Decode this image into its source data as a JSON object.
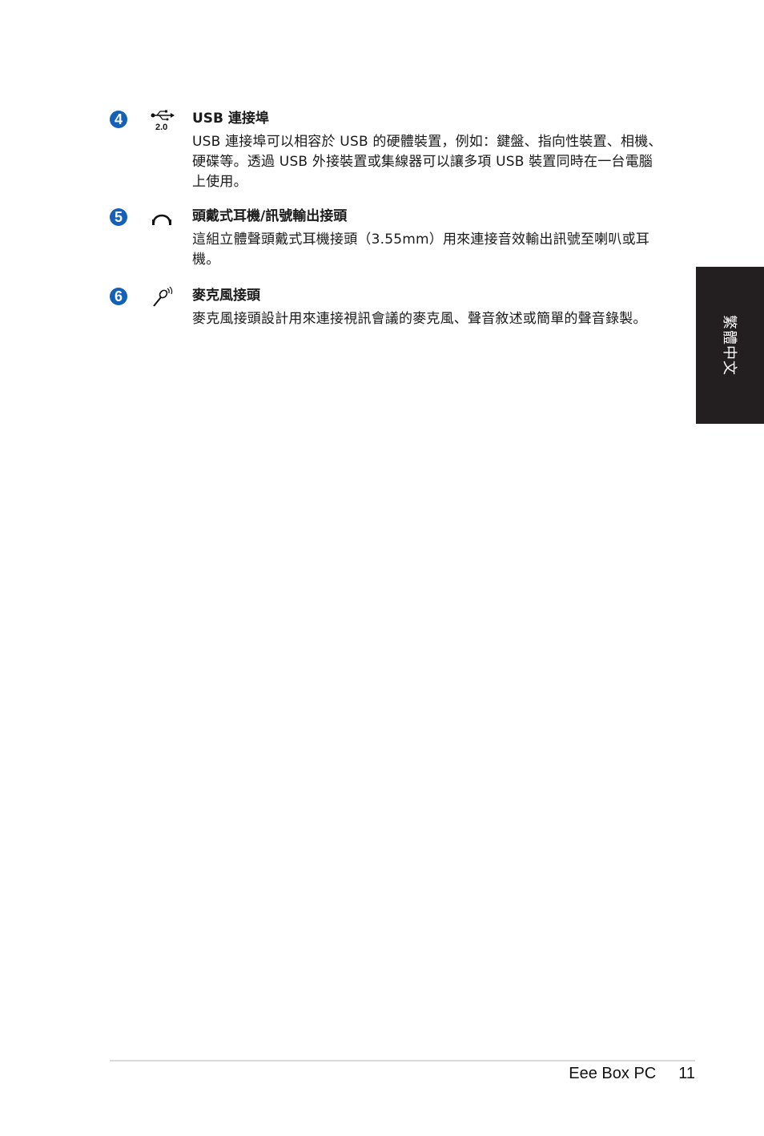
{
  "items": [
    {
      "number": "4",
      "icon": "usb-icon",
      "icon_label": "2.0",
      "title": "USB 連接埠",
      "body": "USB 連接埠可以相容於 USB 的硬體裝置，例如：鍵盤、指向性裝置、相機、硬碟等。透過 USB 外接裝置或集線器可以讓多項 USB 裝置同時在一台電腦上使用。"
    },
    {
      "number": "5",
      "icon": "headphone-icon",
      "title": "頭戴式耳機/訊號輸出接頭",
      "body": "這組立體聲頭戴式耳機接頭（3.55mm）用來連接音效輸出訊號至喇叭或耳機。"
    },
    {
      "number": "6",
      "icon": "microphone-icon",
      "title": "麥克風接頭",
      "body": "麥克風接頭設計用來連接視訊會議的麥克風、聲音敘述或簡單的聲音錄製。"
    }
  ],
  "side_tab": {
    "label": "繁體中文",
    "background": "#231f20"
  },
  "footer": {
    "product": "Eee Box PC",
    "page": "11"
  },
  "colors": {
    "number_badge": "#1560b8"
  }
}
